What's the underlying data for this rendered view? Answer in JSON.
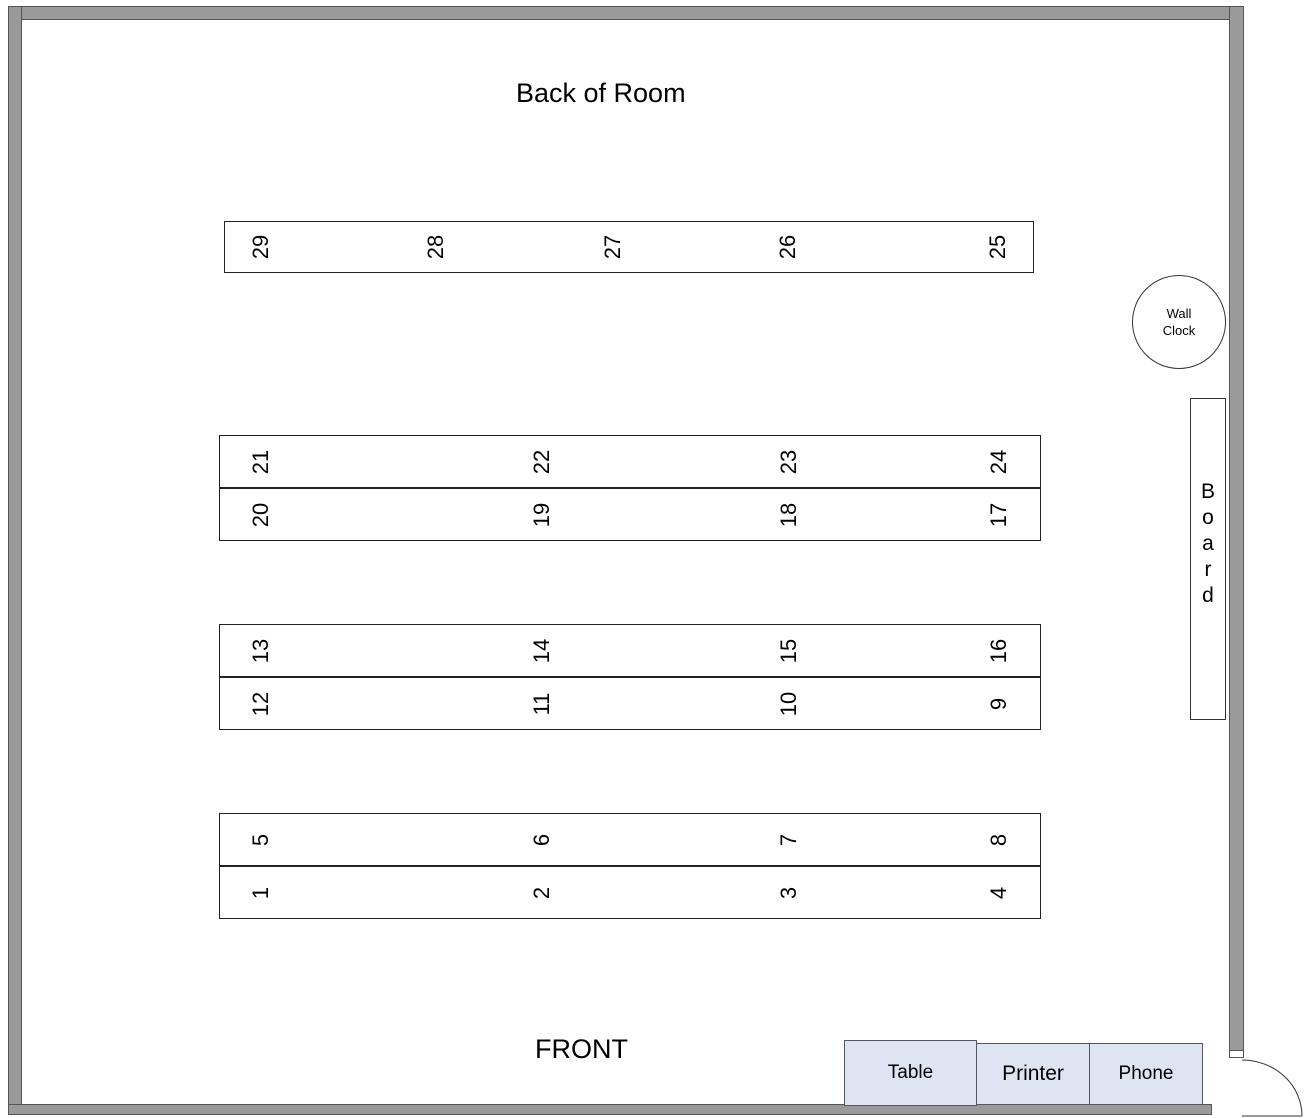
{
  "labels": {
    "back": "Back of Room",
    "front": "FRONT",
    "clock": "Wall\nClock",
    "board": "B\no\na\nr\nd"
  },
  "furniture": {
    "table": "Table",
    "printer": "Printer",
    "phone": "Phone"
  },
  "seating_rows": [
    {
      "name": "row-back",
      "seats": [
        "29",
        "28",
        "27",
        "26",
        "25"
      ]
    },
    {
      "name": "row-3-back",
      "seats": [
        "21",
        "22",
        "23",
        "24"
      ]
    },
    {
      "name": "row-3-front",
      "seats": [
        "20",
        "19",
        "18",
        "17"
      ]
    },
    {
      "name": "row-2-back",
      "seats": [
        "13",
        "14",
        "15",
        "16"
      ]
    },
    {
      "name": "row-2-front",
      "seats": [
        "12",
        "11",
        "10",
        "9"
      ]
    },
    {
      "name": "row-1-back",
      "seats": [
        "5",
        "6",
        "7",
        "8"
      ]
    },
    {
      "name": "row-1-front",
      "seats": [
        "1",
        "2",
        "3",
        "4"
      ]
    }
  ],
  "colors": {
    "wall": "#9a9a9a",
    "furniture_fill": "#dde4f2"
  }
}
